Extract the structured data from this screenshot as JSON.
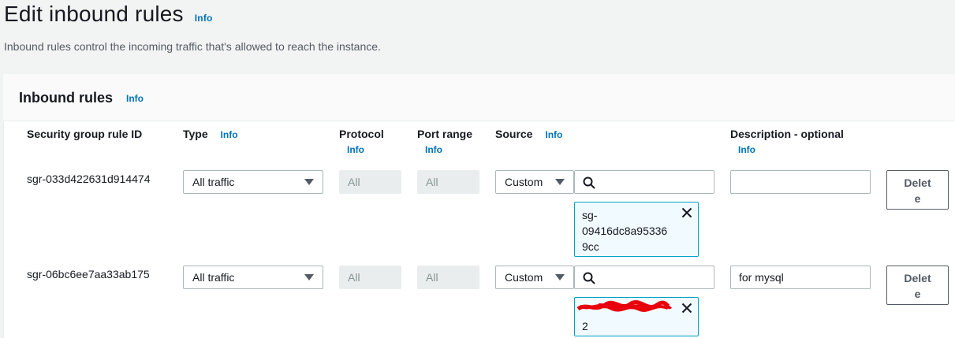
{
  "page": {
    "title": "Edit inbound rules",
    "title_info": "Info",
    "description": "Inbound rules control the incoming traffic that's allowed to reach the instance."
  },
  "panel": {
    "title": "Inbound rules",
    "title_info": "Info"
  },
  "columns": {
    "rule_id": "Security group rule ID",
    "type": "Type",
    "type_info": "Info",
    "protocol": "Protocol",
    "protocol_info": "Info",
    "port_range": "Port range",
    "port_range_info": "Info",
    "source": "Source",
    "source_info": "Info",
    "description": "Description - optional",
    "description_info": "Info"
  },
  "rows": [
    {
      "rule_id": "sgr-033d422631d914474",
      "type": "All traffic",
      "protocol": "All",
      "port_range": "All",
      "source_type": "Custom",
      "source_search": "",
      "token_line1": "sg-",
      "token_line2": "09416dc8a95336",
      "token_line3": "9cc",
      "description": "",
      "delete_line1": "Delet",
      "delete_line2": "e"
    },
    {
      "rule_id": "sgr-06bc6ee7aa33ab175",
      "type": "All traffic",
      "protocol": "All",
      "port_range": "All",
      "source_type": "Custom",
      "source_search": "",
      "token_line2": "2",
      "description": "for mysql",
      "delete_line1": "Delet",
      "delete_line2": "e"
    }
  ],
  "colors": {
    "link": "#0073bb",
    "token_border": "#00a1c9",
    "token_bg": "#f1faff",
    "redaction": "#e8000b"
  }
}
